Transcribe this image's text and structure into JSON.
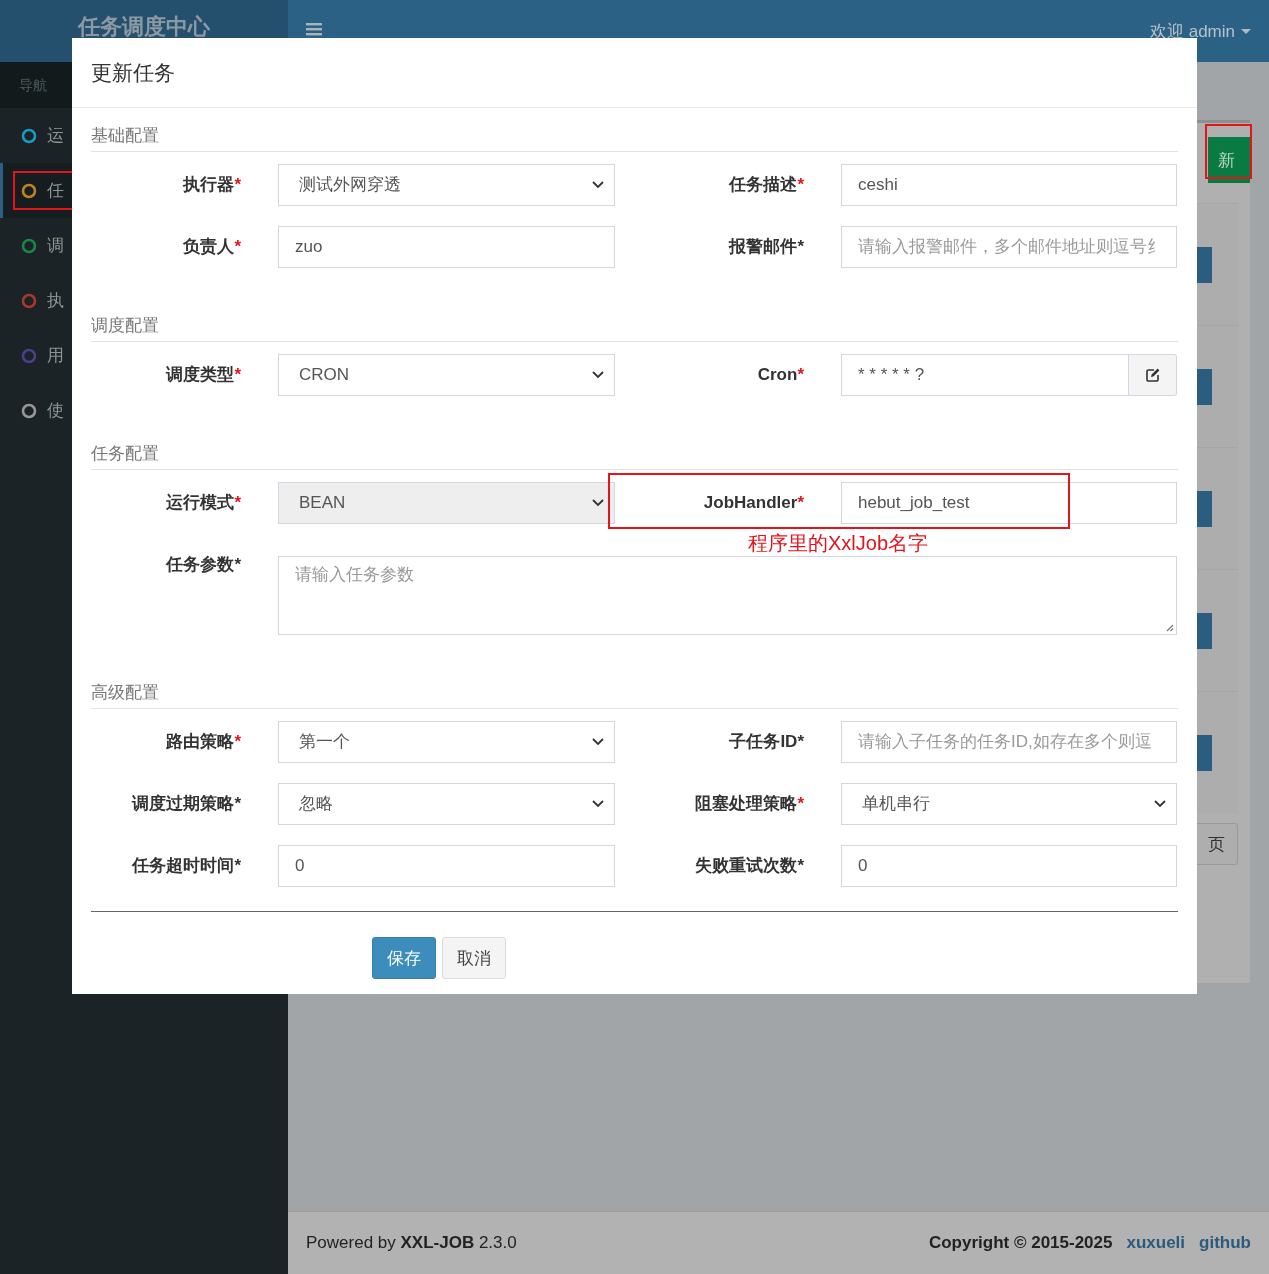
{
  "header": {
    "logo": "任务调度中心",
    "user": "欢迎 admin"
  },
  "sidebar": {
    "heading": "导航",
    "items": [
      {
        "label": "运",
        "color": "#1b9bc4",
        "selected": false,
        "highlighted": false
      },
      {
        "label": "任",
        "color": "#c2841a",
        "selected": true,
        "highlighted": true
      },
      {
        "label": "调",
        "color": "#15874a",
        "selected": false,
        "highlighted": false
      },
      {
        "label": "执",
        "color": "#a8392c",
        "selected": false,
        "highlighted": false
      },
      {
        "label": "用",
        "color": "#4b3f8c",
        "selected": false,
        "highlighted": false
      },
      {
        "label": "使",
        "color": "#989898",
        "selected": false,
        "highlighted": false
      }
    ]
  },
  "main": {
    "add_button": {
      "label": "新",
      "highlighted": true
    },
    "row_buttons": [
      {
        "kind": "action"
      },
      {
        "kind": "action"
      },
      {
        "kind": "action"
      },
      {
        "kind": "action"
      },
      {
        "kind": "action"
      }
    ],
    "pager_button": "页"
  },
  "modal": {
    "title": "更新任务",
    "sections": [
      {
        "title": "基础配置",
        "fields": [
          {
            "label": "执行器",
            "mark": "*",
            "required": true,
            "kind": "select",
            "value": "测试外网穿透",
            "disabled": false
          },
          {
            "label": "任务描述",
            "mark": "*",
            "required": true,
            "kind": "input",
            "value": "ceshi"
          },
          {
            "label": "负责人",
            "mark": "*",
            "required": true,
            "kind": "input",
            "value": "zuo"
          },
          {
            "label": "报警邮件",
            "mark": "*",
            "required": false,
            "kind": "input",
            "placeholder": "请输入报警邮件，多个邮件地址则逗号纟"
          }
        ]
      },
      {
        "title": "调度配置",
        "fields": [
          {
            "label": "调度类型",
            "mark": "*",
            "required": true,
            "kind": "select",
            "value": "CRON",
            "disabled": false
          },
          {
            "label": "Cron",
            "mark": "*",
            "required": true,
            "kind": "cron",
            "value": "* * * * * ?"
          }
        ]
      },
      {
        "title": "任务配置",
        "fields": [
          {
            "label": "运行模式",
            "mark": "*",
            "required": true,
            "kind": "select",
            "value": "BEAN",
            "disabled": true
          },
          {
            "label": "JobHandler",
            "mark": "*",
            "required": true,
            "kind": "input",
            "value": "hebut_job_test",
            "highlighted": true,
            "note": "程序里的XxlJob名字"
          },
          {
            "label": "任务参数",
            "mark": "*",
            "required": false,
            "kind": "textarea",
            "placeholder": "请输入任务参数"
          }
        ]
      },
      {
        "title": "高级配置",
        "fields": [
          {
            "label": "路由策略",
            "mark": "*",
            "required": true,
            "kind": "select",
            "value": "第一个",
            "disabled": false
          },
          {
            "label": "子任务ID",
            "mark": "*",
            "required": false,
            "kind": "input",
            "placeholder": "请输入子任务的任务ID,如存在多个则逗"
          },
          {
            "label": "调度过期策略",
            "mark": "*",
            "required": false,
            "kind": "select",
            "value": "忽略",
            "disabled": false
          },
          {
            "label": "阻塞处理策略",
            "mark": "*",
            "required": true,
            "kind": "select",
            "value": "单机串行",
            "disabled": false
          },
          {
            "label": "任务超时时间",
            "mark": "*",
            "required": false,
            "kind": "input",
            "value": "0"
          },
          {
            "label": "失败重试次数",
            "mark": "*",
            "required": false,
            "kind": "input",
            "value": "0"
          }
        ]
      }
    ],
    "buttons": [
      {
        "label": "保存",
        "kind": "primary"
      },
      {
        "label": "取消",
        "kind": "default"
      }
    ]
  },
  "footer": {
    "powered": "Powered by **XXL-JOB** 2.3.0",
    "copyright": "Copyright © 2015-2025",
    "links": [
      "xuxueli",
      "github"
    ]
  }
}
